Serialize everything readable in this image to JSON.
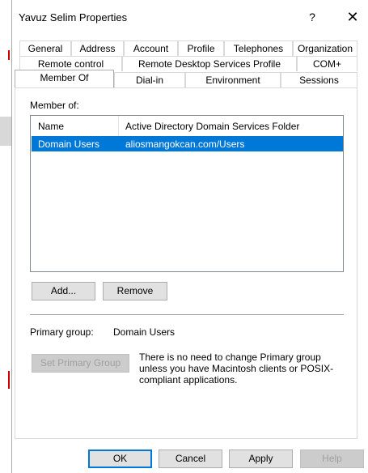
{
  "window": {
    "title": "Yavuz Selim Properties",
    "help_glyph": "?",
    "close_glyph": "✕"
  },
  "tabs": {
    "row1": [
      "General",
      "Address",
      "Account",
      "Profile",
      "Telephones",
      "Organization"
    ],
    "row2": [
      "Remote control",
      "Remote Desktop Services Profile",
      "COM+"
    ],
    "row3": [
      "Member Of",
      "Dial-in",
      "Environment",
      "Sessions"
    ],
    "selected": "Member Of"
  },
  "member_of": {
    "label": "Member of:",
    "columns": [
      "Name",
      "Active Directory Domain Services Folder"
    ],
    "rows": [
      {
        "name": "Domain Users",
        "folder": "aliosmangokcan.com/Users",
        "selected": true
      }
    ]
  },
  "buttons": {
    "add": "Add...",
    "remove": "Remove",
    "set_primary": "Set Primary Group",
    "ok": "OK",
    "cancel": "Cancel",
    "apply": "Apply",
    "help": "Help"
  },
  "primary_group": {
    "label": "Primary group:",
    "value": "Domain Users",
    "note": "There is no need to change Primary group unless you have Macintosh clients or POSIX-compliant applications."
  },
  "colors": {
    "selection": "#0078d7",
    "button_face": "#e1e1e1"
  }
}
